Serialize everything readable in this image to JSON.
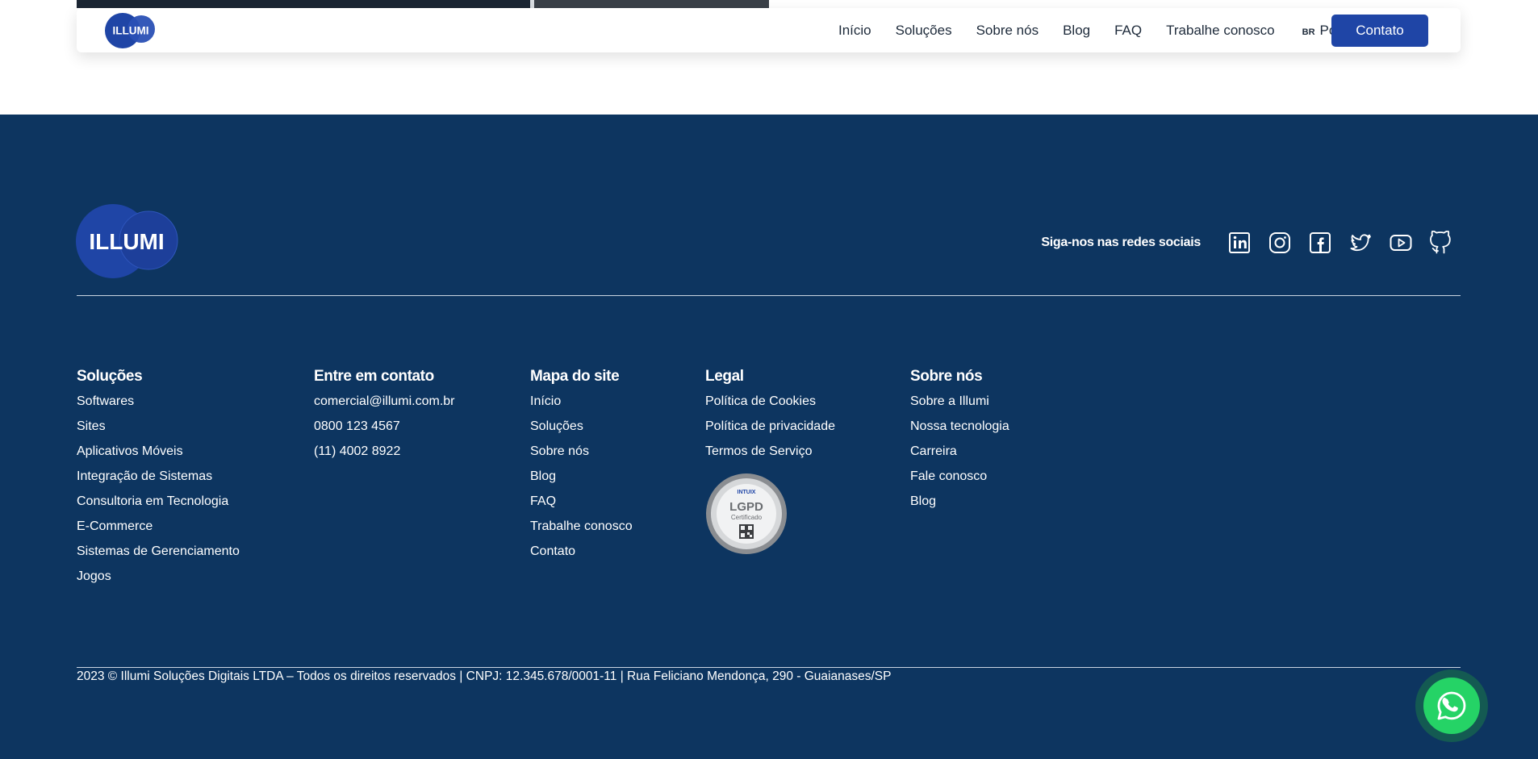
{
  "navbar": {
    "logo_text": "ILLUMI",
    "links": [
      "Início",
      "Soluções",
      "Sobre nós",
      "Blog",
      "FAQ",
      "Trabalhe conosco"
    ],
    "language": {
      "flag": "BR",
      "label": "Português"
    },
    "contact_label": "Contato"
  },
  "footer": {
    "logo_text": "ILLUMI",
    "social": {
      "label": "Siga-nos nas redes sociais",
      "icons": [
        "linkedin-icon",
        "instagram-icon",
        "facebook-icon",
        "twitter-icon",
        "youtube-icon",
        "github-icon"
      ]
    },
    "columns": {
      "solucoes": {
        "title": "Soluções",
        "items": [
          "Softwares",
          "Sites",
          "Aplicativos Móveis",
          "Integração de Sistemas",
          "Consultoria em Tecnologia",
          "E-Commerce",
          "Sistemas de Gerenciamento",
          "Jogos"
        ]
      },
      "contato": {
        "title": "Entre em contato",
        "items": [
          "comercial@illumi.com.br",
          "0800 123 4567",
          "(11) 4002 8922"
        ]
      },
      "mapa": {
        "title": "Mapa do site",
        "items": [
          "Início",
          "Soluções",
          "Sobre nós",
          "Blog",
          "FAQ",
          "Trabalhe conosco",
          "Contato"
        ]
      },
      "legal": {
        "title": "Legal",
        "items": [
          "Política de Cookies",
          "Política de privacidade",
          "Termos de Serviço"
        ],
        "seal": {
          "brand": "INTUIX",
          "title": "LGPD",
          "subtitle": "Certificado"
        }
      },
      "sobre": {
        "title": "Sobre nós",
        "items": [
          "Sobre a Illumi",
          "Nossa tecnologia",
          "Carreira",
          "Fale conosco",
          "Blog"
        ]
      }
    },
    "copyright": "2023 © Illumi Soluções Digitais LTDA – Todos os direitos reservados | CNPJ: 12.345.678/0001-11 | Rua Feliciano Mendonça, 290 - Guaianases/SP"
  },
  "colors": {
    "footer_bg": "#0d3560",
    "brand_blue": "#1f45a6",
    "whatsapp_green": "#25d366"
  }
}
